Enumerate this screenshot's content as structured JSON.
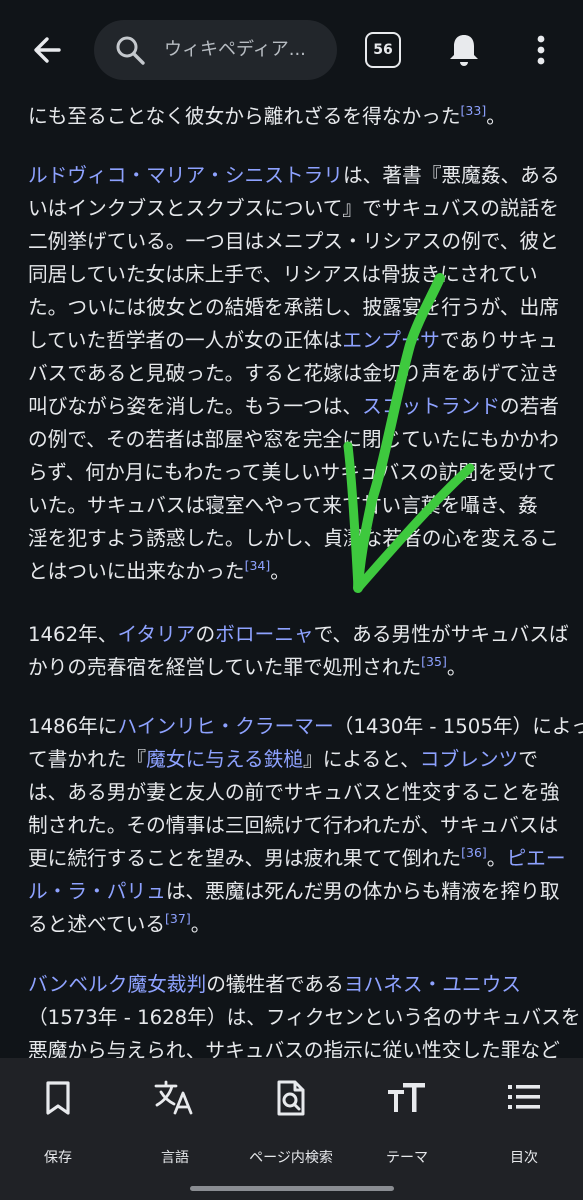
{
  "header": {
    "search_placeholder": "ウィキペディア...",
    "tab_count": "56",
    "icons": [
      "back-arrow-icon",
      "search-icon",
      "bell-icon",
      "more-vert-icon"
    ]
  },
  "article": {
    "p0": {
      "l1": {
        "a": "にも至ることなく彼女から離れざるを得なかった",
        "r": "[33]",
        "b": "。"
      }
    },
    "p1": {
      "l1": {
        "link": "ルドヴィコ・マリア・シニストラリ",
        "a": "は、著書『悪魔姦、ある"
      },
      "l2": "いはインクブスとスクブスについて』でサキュバスの説話を",
      "l3": "二例挙げている。一つ目はメニプス・リシアスの例で、彼と",
      "l4": "同居していた女は床上手で、リシアスは骨抜きにされてい",
      "l5": "た。ついには彼女との結婚を承諾し、披露宴を行うが、出席",
      "l6": {
        "a": "していた哲学者の一人が女の正体は",
        "link": "エンプーサ",
        "b": "でありサキュ"
      },
      "l7": "バスであると見破った。すると花嫁は金切り声をあげて泣き",
      "l8": {
        "a": "叫びながら姿を消した。もう一つは、",
        "link": "スコットランド",
        "b": "の若者"
      },
      "l9": "の例で、その若者は部屋や窓を完全に閉じていたにもかかわ",
      "l10": "らず、何か月にもわたって美しいサキュバスの訪問を受けて",
      "l11": "いた。サキュバスは寝室へやって来て甘い言葉を囁き、姦",
      "l12": "淫を犯すよう誘惑した。しかし、貞潔な若者の心を変えるこ",
      "l13": {
        "a": "とはついに出来なかった",
        "r": "[34]",
        "b": "。"
      }
    },
    "p2": {
      "l1": {
        "a": "1462年、",
        "link1": "イタリア",
        "b": "の",
        "link2": "ボローニャ",
        "c": "で、ある男性がサキュバスば"
      },
      "l2": {
        "a": "かりの売春宿を経営していた罪で処刑された",
        "r": "[35]",
        "b": "。"
      }
    },
    "p3": {
      "l1": {
        "a": "1486年に",
        "link": "ハインリヒ・クラーマー",
        "b": "（1430年 - 1505年）によっ"
      },
      "l2": {
        "a": "て書かれた『",
        "link1": "魔女に与える鉄槌",
        "b": "』によると、",
        "link2": "コブレンツ",
        "c": "で"
      },
      "l3": "は、ある男が妻と友人の前でサキュバスと性交することを強",
      "l4": "制された。その情事は三回続けて行われたが、サキュバスは",
      "l5": {
        "a": "更に続行することを望み、男は疲れ果てて倒れた",
        "r": "[36]",
        "b": "。",
        "link": "ピエー"
      },
      "l6": {
        "link": "ル・ラ・パリュ",
        "a": "は、悪魔は死んだ男の体からも精液を搾り取"
      },
      "l7": {
        "a": "ると述べている",
        "r": "[37]",
        "b": "。"
      }
    },
    "p4": {
      "l1": {
        "link1": "バンベルク",
        "link2": "魔女裁判",
        "a": "の犠牲者である",
        "link3": "ヨハネス・ユニウス",
        "b": ""
      },
      "l2": "（1573年 - 1628年）は、フィクセンという名のサキュバスを",
      "l3": "悪魔から与えられ、サキュバスの指示に従い性交した罪など"
    }
  },
  "toolbar": {
    "items": [
      {
        "label": "保存",
        "icon": "bookmark-icon"
      },
      {
        "label": "言語",
        "icon": "translate-icon"
      },
      {
        "label": "ページ内検索",
        "icon": "find-in-page-icon"
      },
      {
        "label": "テーマ",
        "icon": "text-size-icon"
      },
      {
        "label": "目次",
        "icon": "toc-list-icon"
      }
    ]
  },
  "colors": {
    "background": "#101418",
    "text": "#e6e8eb",
    "link": "#8ea2ff",
    "annotation_arrow": "#3ec93e",
    "toolbar_bg": "#202226"
  }
}
